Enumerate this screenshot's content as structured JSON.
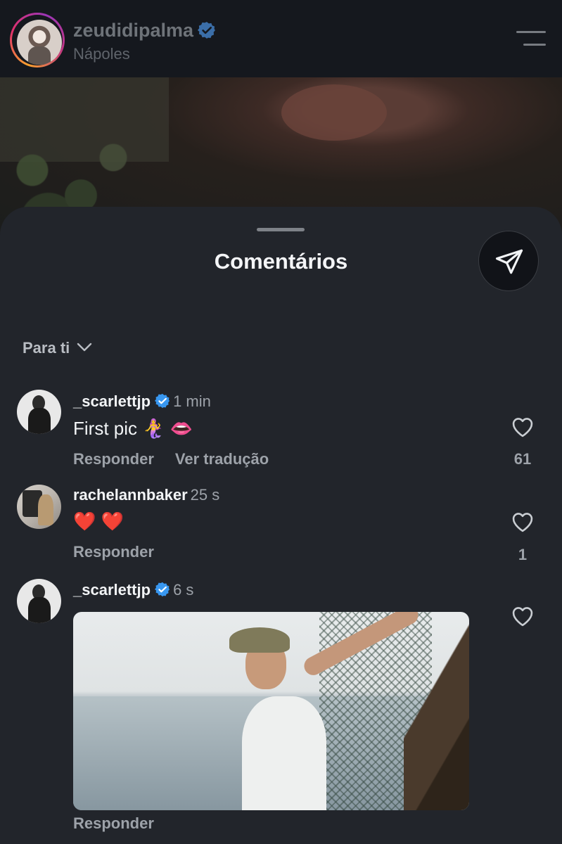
{
  "header": {
    "username": "zeudidipalma",
    "location": "Nápoles"
  },
  "sheet": {
    "title": "Comentários",
    "sort_label": "Para ti"
  },
  "comments": [
    {
      "username": "_scarlettjp",
      "verified": true,
      "time": "1 min",
      "text": "First pic 🧜‍♀️ 👄",
      "actions": [
        "Responder",
        "Ver tradução"
      ],
      "likes": "61"
    },
    {
      "username": "rachelannbaker",
      "verified": false,
      "time": "25 s",
      "text": "❤️ ❤️",
      "actions": [
        "Responder"
      ],
      "likes": "1"
    },
    {
      "username": "_scarlettjp",
      "verified": true,
      "time": "6 s",
      "text": "",
      "actions": [
        "Responder"
      ],
      "likes": ""
    }
  ],
  "colors": {
    "background": "#15181e",
    "sheet": "#22252b",
    "verified_blue": "#3897f0",
    "muted_text": "#9da2a9"
  },
  "icons": [
    "verified-badge-icon",
    "menu-icon",
    "paper-plane-icon",
    "chevron-down-icon",
    "heart-icon"
  ]
}
